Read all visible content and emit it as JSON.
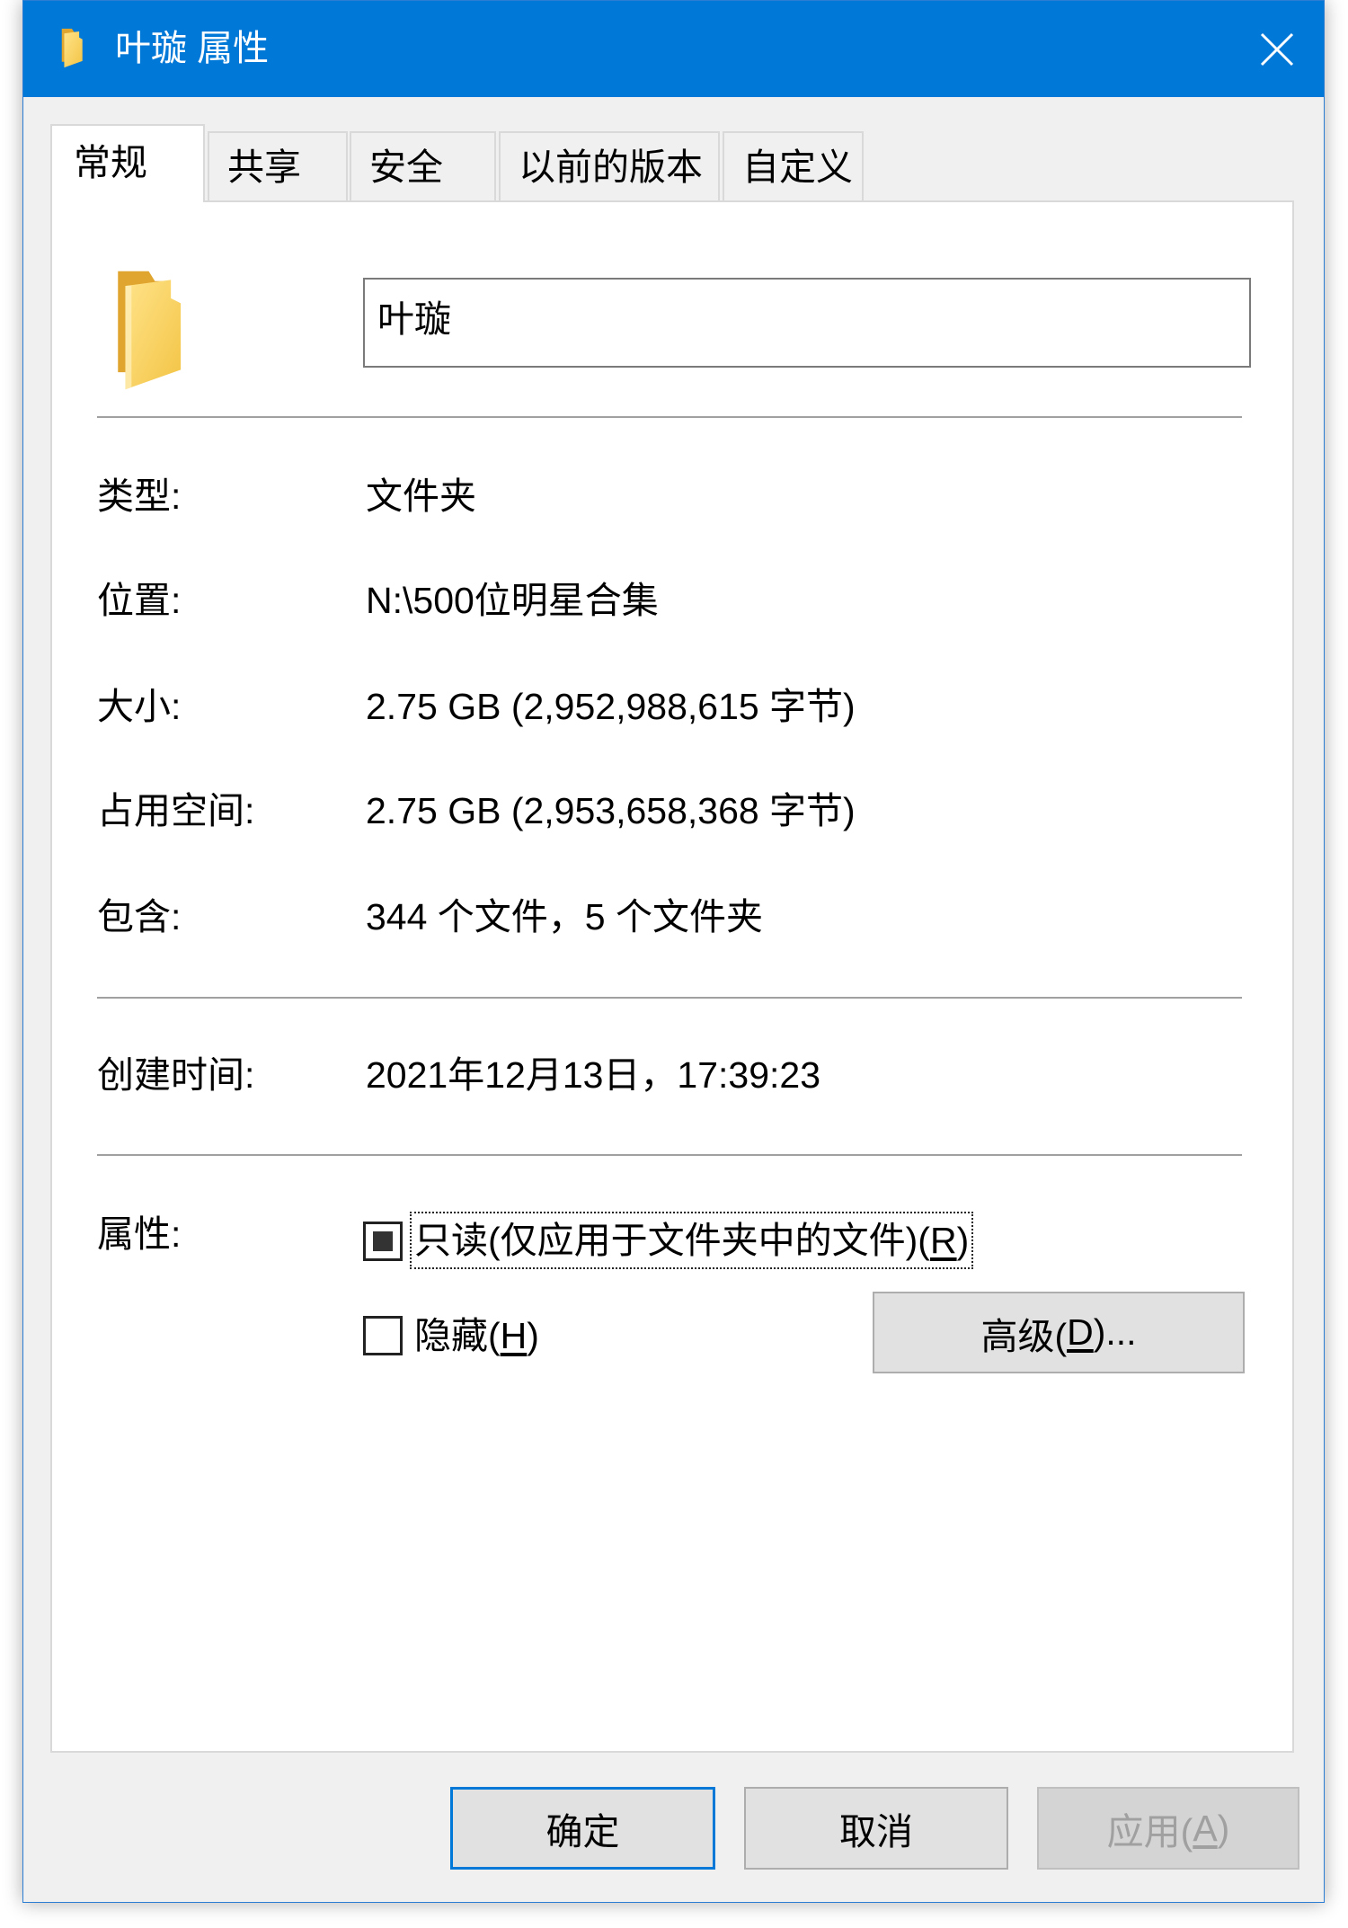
{
  "window": {
    "title": "叶璇 属性",
    "title_icon": "folder-icon",
    "close_icon": "close-icon"
  },
  "tabs": [
    {
      "label": "常规",
      "selected": true
    },
    {
      "label": "共享",
      "selected": false
    },
    {
      "label": "安全",
      "selected": false
    },
    {
      "label": "以前的版本",
      "selected": false
    },
    {
      "label": "自定义",
      "selected": false
    }
  ],
  "general": {
    "icon": "folder-icon",
    "name": "叶璇",
    "details": [
      {
        "label": "类型:",
        "value": "文件夹"
      },
      {
        "label": "位置:",
        "value": "N:\\500位明星合集"
      },
      {
        "label": "大小:",
        "value": "2.75 GB (2,952,988,615 字节)"
      },
      {
        "label": "占用空间:",
        "value": "2.75 GB (2,953,658,368 字节)"
      },
      {
        "label": "包含:",
        "value": "344 个文件，5 个文件夹"
      }
    ],
    "created": {
      "label": "创建时间:",
      "value": "2021年12月13日，17:39:23"
    },
    "attributes": {
      "label": "属性:",
      "read_only": {
        "prefix": "只读(仅应用于文件夹中的文件)(",
        "access_key": "R",
        "suffix": ")",
        "checked": true,
        "indeterminate": true
      },
      "hidden": {
        "prefix": "隐藏(",
        "access_key": "H",
        "suffix": ")",
        "checked": false
      },
      "advanced_button": {
        "prefix": "高级(",
        "access_key": "D",
        "suffix": ")..."
      }
    }
  },
  "footer": {
    "ok": "确定",
    "cancel": "取消",
    "apply": {
      "prefix": "应用(",
      "access_key": "A",
      "suffix": ")",
      "enabled": false
    }
  },
  "colors": {
    "title_bar": "#0078d7",
    "dialog_background": "#f0f0f0",
    "panel_background": "#ffffff",
    "default_button_border": "#0078d7",
    "disabled_text": "#a0a0a0"
  }
}
